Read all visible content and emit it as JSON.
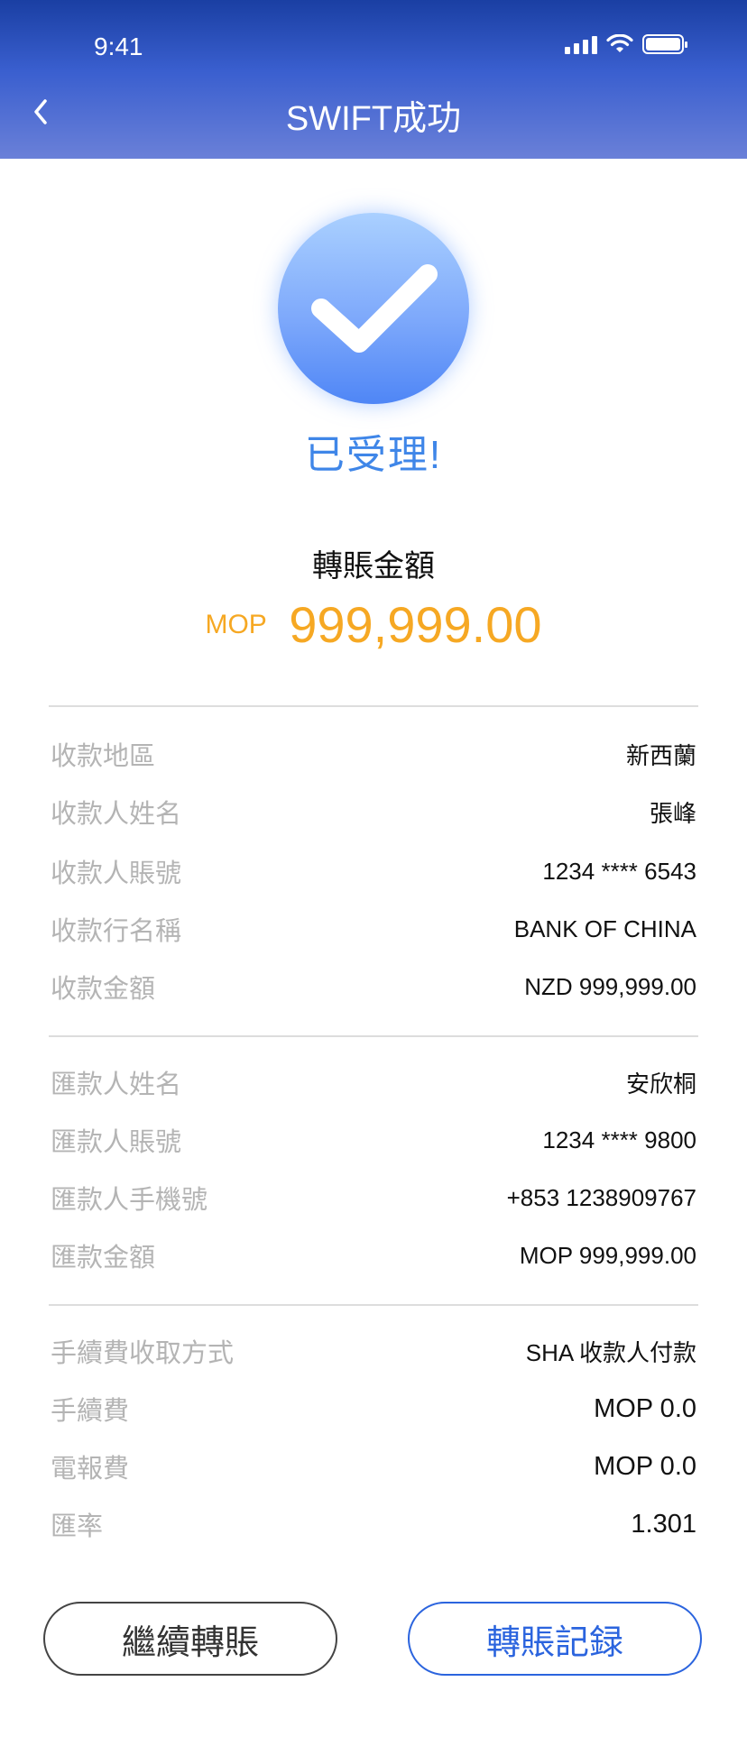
{
  "status_bar": {
    "time": "9:41"
  },
  "nav": {
    "title": "SWIFT成功"
  },
  "status": {
    "title": "已受理!"
  },
  "amount": {
    "label": "轉賬金額",
    "currency": "MOP",
    "value": "999,999.00"
  },
  "payee_section": [
    {
      "label": "收款地區",
      "value": "新西蘭"
    },
    {
      "label": "收款人姓名",
      "value": "張峰"
    },
    {
      "label": "收款人賬號",
      "value": "1234 **** 6543"
    },
    {
      "label": "收款行名稱",
      "value": "BANK OF CHINA"
    },
    {
      "label": "收款金額",
      "value": "NZD  999,999.00"
    }
  ],
  "payer_section": [
    {
      "label": "匯款人姓名",
      "value": "安欣桐"
    },
    {
      "label": "匯款人賬號",
      "value": "1234 **** 9800"
    },
    {
      "label": "匯款人手機號",
      "value": "+853 1238909767"
    },
    {
      "label": "匯款金額",
      "value": "MOP  999,999.00"
    }
  ],
  "fee_section": [
    {
      "label": "手續費收取方式",
      "value": "SHA 收款人付款"
    },
    {
      "label": "手續費",
      "value": "MOP 0.0"
    },
    {
      "label": "電報費",
      "value": "MOP 0.0"
    },
    {
      "label": "匯率",
      "value": "1.301"
    }
  ],
  "buttons": {
    "continue": "繼續轉賬",
    "records": "轉賬記録"
  },
  "colors": {
    "header_top": "#1a3fa3",
    "header_bottom": "#6a80d8",
    "amount": "#f6a823",
    "accent": "#2b64de",
    "status": "#3f86e8"
  },
  "icons": {
    "back": "chevron-left-icon",
    "signal": "signal-icon",
    "wifi": "wifi-icon",
    "battery": "battery-icon",
    "success": "checkmark-icon"
  }
}
